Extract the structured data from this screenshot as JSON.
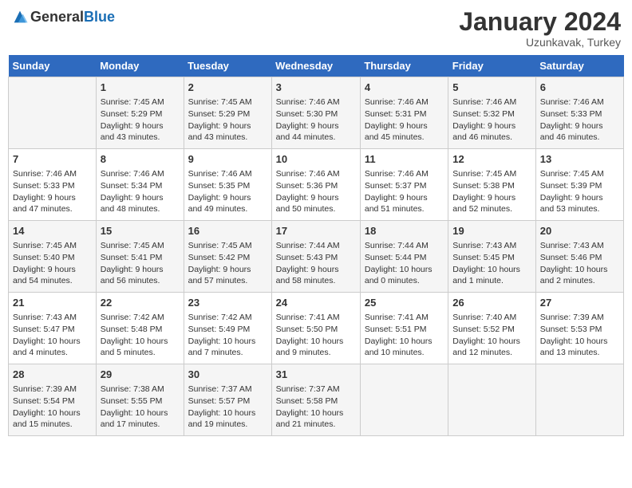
{
  "header": {
    "logo_general": "General",
    "logo_blue": "Blue",
    "title": "January 2024",
    "location": "Uzunkavak, Turkey"
  },
  "days_of_week": [
    "Sunday",
    "Monday",
    "Tuesday",
    "Wednesday",
    "Thursday",
    "Friday",
    "Saturday"
  ],
  "weeks": [
    [
      {
        "day": "",
        "info": ""
      },
      {
        "day": "1",
        "info": "Sunrise: 7:45 AM\nSunset: 5:29 PM\nDaylight: 9 hours\nand 43 minutes."
      },
      {
        "day": "2",
        "info": "Sunrise: 7:45 AM\nSunset: 5:29 PM\nDaylight: 9 hours\nand 43 minutes."
      },
      {
        "day": "3",
        "info": "Sunrise: 7:46 AM\nSunset: 5:30 PM\nDaylight: 9 hours\nand 44 minutes."
      },
      {
        "day": "4",
        "info": "Sunrise: 7:46 AM\nSunset: 5:31 PM\nDaylight: 9 hours\nand 45 minutes."
      },
      {
        "day": "5",
        "info": "Sunrise: 7:46 AM\nSunset: 5:32 PM\nDaylight: 9 hours\nand 46 minutes."
      },
      {
        "day": "6",
        "info": "Sunrise: 7:46 AM\nSunset: 5:33 PM\nDaylight: 9 hours\nand 46 minutes."
      }
    ],
    [
      {
        "day": "7",
        "info": "Sunrise: 7:46 AM\nSunset: 5:33 PM\nDaylight: 9 hours\nand 47 minutes."
      },
      {
        "day": "8",
        "info": "Sunrise: 7:46 AM\nSunset: 5:34 PM\nDaylight: 9 hours\nand 48 minutes."
      },
      {
        "day": "9",
        "info": "Sunrise: 7:46 AM\nSunset: 5:35 PM\nDaylight: 9 hours\nand 49 minutes."
      },
      {
        "day": "10",
        "info": "Sunrise: 7:46 AM\nSunset: 5:36 PM\nDaylight: 9 hours\nand 50 minutes."
      },
      {
        "day": "11",
        "info": "Sunrise: 7:46 AM\nSunset: 5:37 PM\nDaylight: 9 hours\nand 51 minutes."
      },
      {
        "day": "12",
        "info": "Sunrise: 7:45 AM\nSunset: 5:38 PM\nDaylight: 9 hours\nand 52 minutes."
      },
      {
        "day": "13",
        "info": "Sunrise: 7:45 AM\nSunset: 5:39 PM\nDaylight: 9 hours\nand 53 minutes."
      }
    ],
    [
      {
        "day": "14",
        "info": "Sunrise: 7:45 AM\nSunset: 5:40 PM\nDaylight: 9 hours\nand 54 minutes."
      },
      {
        "day": "15",
        "info": "Sunrise: 7:45 AM\nSunset: 5:41 PM\nDaylight: 9 hours\nand 56 minutes."
      },
      {
        "day": "16",
        "info": "Sunrise: 7:45 AM\nSunset: 5:42 PM\nDaylight: 9 hours\nand 57 minutes."
      },
      {
        "day": "17",
        "info": "Sunrise: 7:44 AM\nSunset: 5:43 PM\nDaylight: 9 hours\nand 58 minutes."
      },
      {
        "day": "18",
        "info": "Sunrise: 7:44 AM\nSunset: 5:44 PM\nDaylight: 10 hours\nand 0 minutes."
      },
      {
        "day": "19",
        "info": "Sunrise: 7:43 AM\nSunset: 5:45 PM\nDaylight: 10 hours\nand 1 minute."
      },
      {
        "day": "20",
        "info": "Sunrise: 7:43 AM\nSunset: 5:46 PM\nDaylight: 10 hours\nand 2 minutes."
      }
    ],
    [
      {
        "day": "21",
        "info": "Sunrise: 7:43 AM\nSunset: 5:47 PM\nDaylight: 10 hours\nand 4 minutes."
      },
      {
        "day": "22",
        "info": "Sunrise: 7:42 AM\nSunset: 5:48 PM\nDaylight: 10 hours\nand 5 minutes."
      },
      {
        "day": "23",
        "info": "Sunrise: 7:42 AM\nSunset: 5:49 PM\nDaylight: 10 hours\nand 7 minutes."
      },
      {
        "day": "24",
        "info": "Sunrise: 7:41 AM\nSunset: 5:50 PM\nDaylight: 10 hours\nand 9 minutes."
      },
      {
        "day": "25",
        "info": "Sunrise: 7:41 AM\nSunset: 5:51 PM\nDaylight: 10 hours\nand 10 minutes."
      },
      {
        "day": "26",
        "info": "Sunrise: 7:40 AM\nSunset: 5:52 PM\nDaylight: 10 hours\nand 12 minutes."
      },
      {
        "day": "27",
        "info": "Sunrise: 7:39 AM\nSunset: 5:53 PM\nDaylight: 10 hours\nand 13 minutes."
      }
    ],
    [
      {
        "day": "28",
        "info": "Sunrise: 7:39 AM\nSunset: 5:54 PM\nDaylight: 10 hours\nand 15 minutes."
      },
      {
        "day": "29",
        "info": "Sunrise: 7:38 AM\nSunset: 5:55 PM\nDaylight: 10 hours\nand 17 minutes."
      },
      {
        "day": "30",
        "info": "Sunrise: 7:37 AM\nSunset: 5:57 PM\nDaylight: 10 hours\nand 19 minutes."
      },
      {
        "day": "31",
        "info": "Sunrise: 7:37 AM\nSunset: 5:58 PM\nDaylight: 10 hours\nand 21 minutes."
      },
      {
        "day": "",
        "info": ""
      },
      {
        "day": "",
        "info": ""
      },
      {
        "day": "",
        "info": ""
      }
    ]
  ]
}
